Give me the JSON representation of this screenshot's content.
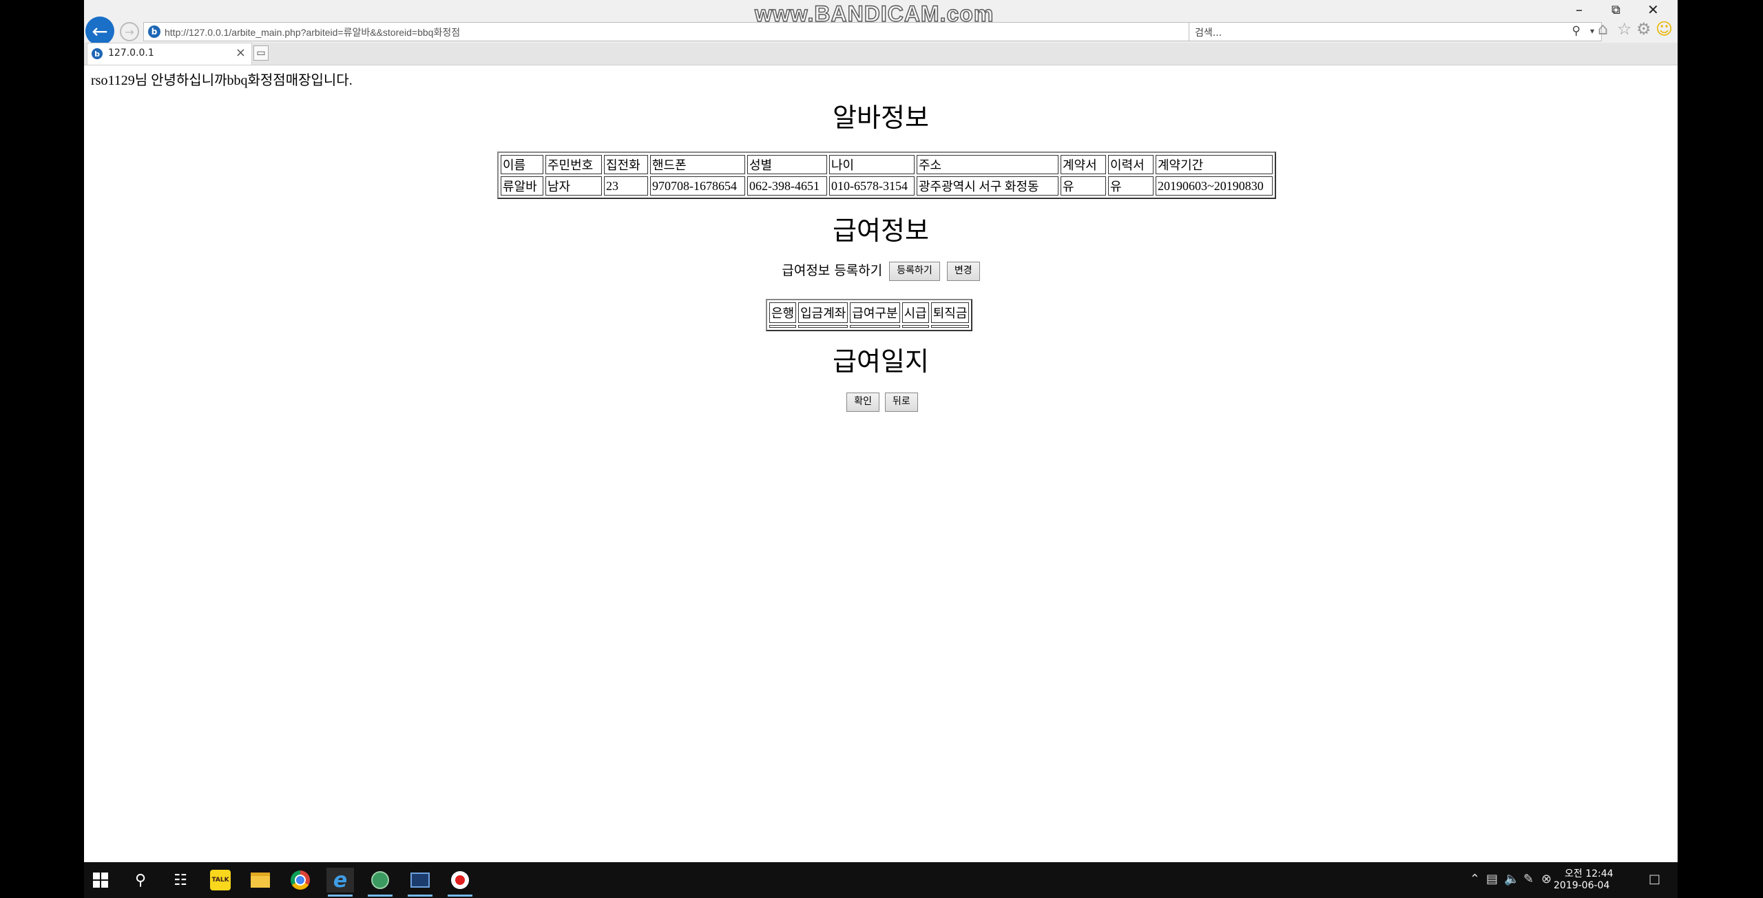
{
  "browser": {
    "url": "http://127.0.0.1/arbite_main.php?arbiteid=류알바&&storeid=bbq화정점",
    "search_placeholder": "검색...",
    "tab_title": "127.0.0.1",
    "watermark": "www.BANDICAM.com"
  },
  "page": {
    "greeting": "rso1129님 안녕하십니까bbq화정점매장입니다.",
    "alba_title": "알바정보",
    "alba_table": {
      "headers": [
        "이름",
        "주민번호",
        "집전화",
        "핸드폰",
        "성별",
        "나이",
        "주소",
        "계약서",
        "이력서",
        "계약기간"
      ],
      "row": [
        "류알바",
        "남자",
        "23",
        "970708-1678654",
        "062-398-4651",
        "010-6578-3154",
        "광주광역시 서구 화정동",
        "유",
        "유",
        "20190603~20190830"
      ]
    },
    "pay_title": "급여정보",
    "pay_register_label": "급여정보 등록하기",
    "register_button": "등록하기",
    "change_button": "변경",
    "pay_table": {
      "headers": [
        "은행",
        "입금계좌",
        "급여구분",
        "시급",
        "퇴직금"
      ]
    },
    "paylog_title": "급여일지",
    "confirm_button": "확인",
    "back_button": "뒤로"
  },
  "taskbar": {
    "time": "오전 12:44",
    "date": "2019-06-04",
    "kakao_label": "TALK"
  }
}
